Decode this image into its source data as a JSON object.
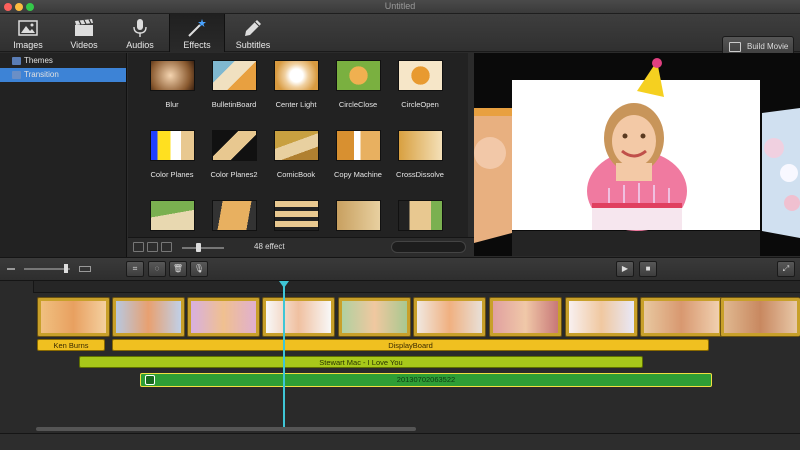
{
  "window": {
    "title": "Untitled",
    "close_color": "#fc605c",
    "min_color": "#fdbc40",
    "max_color": "#34c84a"
  },
  "toolbar": {
    "tabs": [
      {
        "label": "Images",
        "icon": "images-icon"
      },
      {
        "label": "Videos",
        "icon": "clapperboard-icon"
      },
      {
        "label": "Audios",
        "icon": "microphone-icon"
      },
      {
        "label": "Effects",
        "icon": "magic-wand-icon",
        "active": true
      },
      {
        "label": "Subtitles",
        "icon": "pencil-icon"
      }
    ],
    "build_label": "Build Movie"
  },
  "sidebar": {
    "items": [
      {
        "label": "Themes",
        "selected": false
      },
      {
        "label": "Transition",
        "selected": true
      }
    ]
  },
  "effects": {
    "items": [
      {
        "label": "Blur"
      },
      {
        "label": "BulletinBoard"
      },
      {
        "label": "Center Light"
      },
      {
        "label": "CircleClose"
      },
      {
        "label": "CircleOpen"
      },
      {
        "label": "Color Planes"
      },
      {
        "label": "Color Planes2"
      },
      {
        "label": "ComicBook"
      },
      {
        "label": "Copy Machine"
      },
      {
        "label": "CrossDissolve"
      },
      {
        "label": ""
      },
      {
        "label": ""
      },
      {
        "label": ""
      },
      {
        "label": ""
      },
      {
        "label": ""
      }
    ],
    "count_label": "48 effect",
    "search_placeholder": ""
  },
  "timeline": {
    "clip_count": 10,
    "effect_tracks": [
      {
        "label": "Ken Burns"
      },
      {
        "label": "DisplayBoard"
      }
    ],
    "music_track": {
      "label": "Stewart Mac - I Love You"
    },
    "voice_track": {
      "label": "20130702063522"
    },
    "colors": {
      "effect_track": "#f0c020",
      "music_track": "#a8c81a",
      "voice_track": "#2e9e35",
      "playhead": "#3fc6d6"
    }
  }
}
